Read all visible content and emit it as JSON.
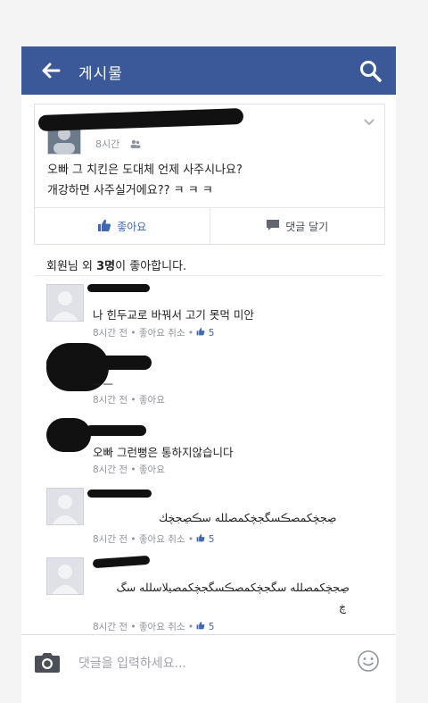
{
  "header": {
    "title": "게시물",
    "back_icon": "back-arrow-icon",
    "search_icon": "search-icon",
    "bg_color": "#3b5898"
  },
  "post": {
    "time": "8시간",
    "text": "오빠 그 치킨은 도대체 언제 사주시나요?\n개강하면 사주실거에요?? ㅋ ㅋ ㅋ",
    "like_label": "좋아요",
    "comment_label": "댓글 달기"
  },
  "likes_summary": {
    "name": "회원님 외",
    "count": "3명",
    "suffix": "이 좋아합니다."
  },
  "comments": [
    {
      "text": "나 힌두교로 바꿔서 고기 못먹 미안",
      "time": "8시간 전",
      "like": "좋아요",
      "cancel": "취소",
      "likes": "5"
    },
    {
      "text": "ㅡㅡ",
      "time": "8시간 전",
      "like": "좋아요"
    },
    {
      "text": "오빠 그런뻥은 통하지않습니다",
      "time": "8시간 전",
      "like": "좋아요"
    },
    {
      "text": "ڝجڿكمصڪسگجڿكمصلله سڪڝجڿك",
      "time": "8시간 전",
      "like": "좋아요",
      "cancel": "취소",
      "likes": "5"
    },
    {
      "text": "ڝجڿكمصلله سگجڿكمصڪسگجڿكمصيلاسلله سگ",
      "text2": "ڿ",
      "time": "8시간 전",
      "like": "좋아요",
      "cancel": "취소",
      "likes": "5"
    }
  ],
  "composer": {
    "placeholder": "댓글을 입력하세요...",
    "camera_icon": "camera-icon",
    "emoji_icon": "smiley-icon"
  }
}
